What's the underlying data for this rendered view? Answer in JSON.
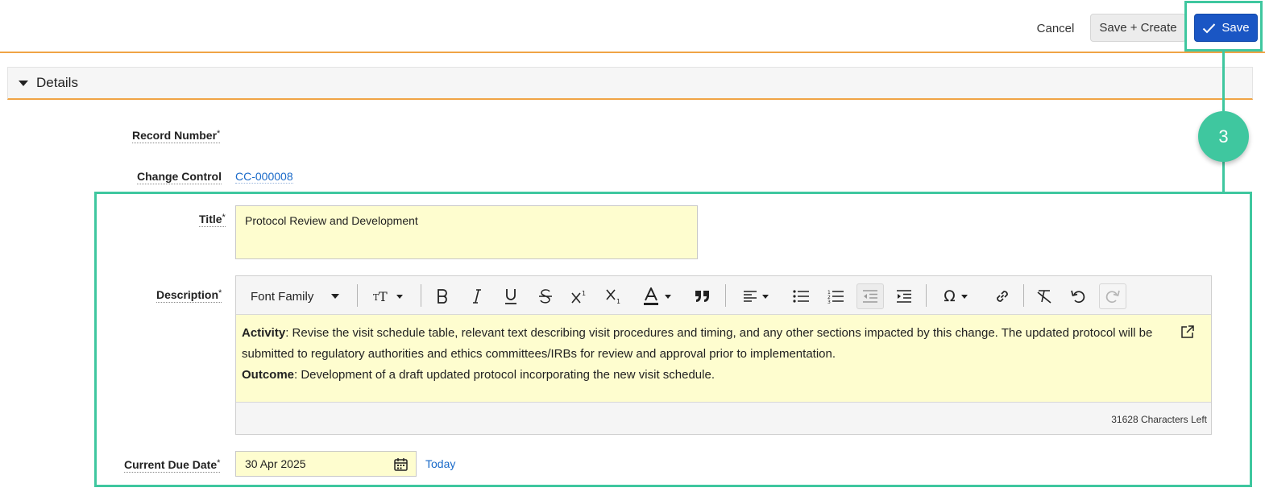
{
  "actions": {
    "cancel_label": "Cancel",
    "save_create_label": "Save + Create",
    "save_label": "Save"
  },
  "section": {
    "title": "Details"
  },
  "fields": {
    "record_number": {
      "label": "Record Number",
      "required_mark": "*",
      "value": ""
    },
    "change_control": {
      "label": "Change Control",
      "value": "CC-000008"
    },
    "title": {
      "label": "Title",
      "required_mark": "*",
      "value": "Protocol Review and Development"
    },
    "description": {
      "label": "Description",
      "required_mark": "*",
      "toolbar": {
        "font_family_label": "Font Family",
        "buttons": [
          "font-size",
          "bold",
          "italic",
          "underline",
          "strikethrough",
          "superscript",
          "subscript",
          "font-color",
          "blockquote",
          "align",
          "bullet-list",
          "numbered-list",
          "outdent",
          "indent",
          "special-character",
          "link",
          "clear-formatting",
          "undo",
          "redo"
        ]
      },
      "paragraphs": [
        {
          "lead": "Activity",
          "text": ": Revise the visit schedule table, relevant text describing visit procedures and timing, and any other sections impacted by this change. The updated protocol will be submitted to regulatory authorities and ethics committees/IRBs for review and approval prior to implementation."
        },
        {
          "lead": "Outcome",
          "text": ": Development of a draft updated protocol incorporating the new visit schedule."
        }
      ],
      "chars_left": "31628 Characters Left"
    },
    "current_due_date": {
      "label": "Current Due Date",
      "required_mark": "*",
      "value": "30 Apr 2025",
      "today_label": "Today"
    }
  },
  "annotation": {
    "step_number": "3",
    "color": "#3fc79f"
  },
  "colors": {
    "primary": "#1a56c4",
    "accent_border": "#f0a445",
    "input_fill": "#fefdcf",
    "link": "#1a6ac9"
  }
}
